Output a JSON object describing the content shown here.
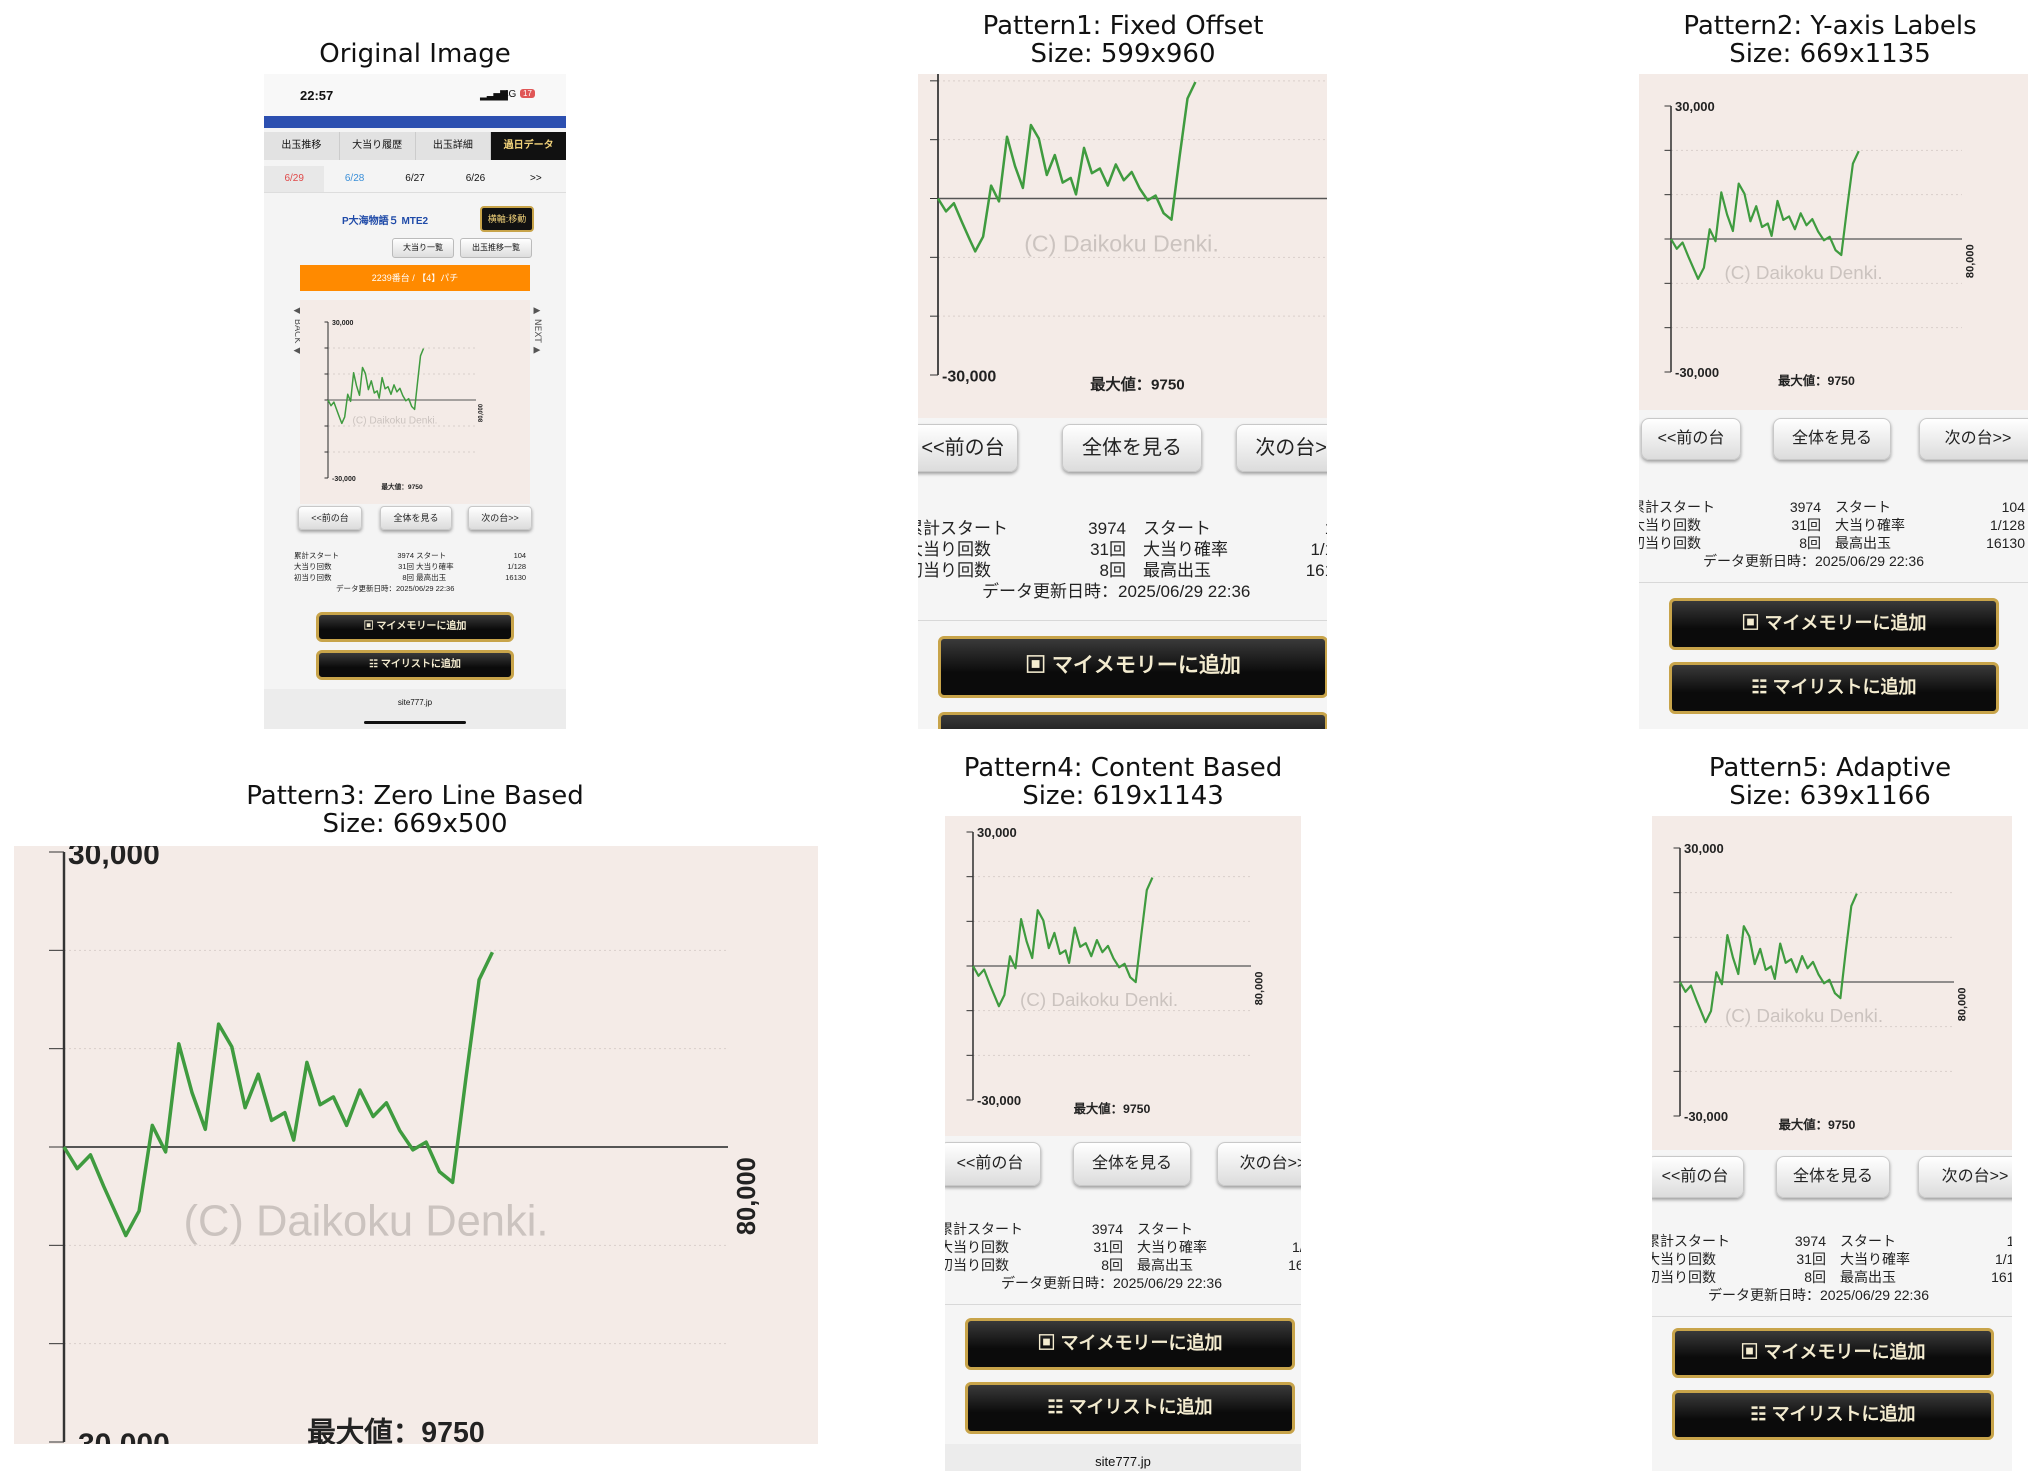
{
  "panels": {
    "original": {
      "title": "Original Image"
    },
    "p1": {
      "title": "Pattern1: Fixed Offset",
      "size": "Size: 599x960"
    },
    "p2": {
      "title": "Pattern2: Y-axis Labels",
      "size": "Size: 669x1135"
    },
    "p3": {
      "title": "Pattern3: Zero Line Based",
      "size": "Size: 669x500"
    },
    "p4": {
      "title": "Pattern4: Content Based",
      "size": "Size: 619x1143"
    },
    "p5": {
      "title": "Pattern5: Adaptive",
      "size": "Size: 639x1166"
    }
  },
  "phone": {
    "time": "22:57",
    "network": "4G",
    "battery": "17",
    "tabs": [
      "出玉推移",
      "大当り履歴",
      "出玉詳細",
      "過日データ"
    ],
    "dates": [
      "6/29",
      "6/28",
      "6/27",
      "6/26",
      ">>"
    ],
    "machine_name": "P大海物語５ MTE2",
    "move_button": "横軸:移動",
    "list_buttons": [
      "大当り一覧",
      "出玉推移一覧"
    ],
    "banner": "2239番台 / 【4】パチ",
    "back_label": "BACK",
    "next_label": "NEXT",
    "footer": "site777.jp"
  },
  "graph": {
    "y_top": "30,000",
    "y_bottom": "-30,000",
    "right_label": "80,000",
    "watermark": "(C) Daikoku Denki.",
    "max_value": "最大値：9750"
  },
  "nav_buttons": {
    "prev": "<<前の台",
    "all": "全体を見る",
    "next": "次の台>>"
  },
  "stats": {
    "total_start_label": "累計スタート",
    "total_start": "3974",
    "start_label": "スタート",
    "start": "104",
    "jackpot_label": "大当り回数",
    "jackpot": "31回",
    "prob_label": "大当り確率",
    "prob": "1/128",
    "first_label": "初当り回数",
    "first": "8回",
    "max_label": "最高出玉",
    "max": "16130",
    "updated": "データ更新日時：2025/06/29 22:36"
  },
  "actions": {
    "memory": "マイメモリーに追加",
    "list": "マイリストに追加"
  },
  "chart_data": {
    "type": "line",
    "ylim": [
      -30000,
      30000
    ],
    "x": [
      0,
      3,
      6,
      9,
      12,
      14,
      17,
      20,
      23,
      26,
      29,
      32,
      35,
      38,
      41,
      44,
      47,
      50,
      52,
      55,
      58,
      61,
      64,
      67,
      70,
      73,
      76,
      79,
      82,
      85,
      88,
      91,
      94,
      97
    ],
    "y": [
      0,
      -2200,
      -800,
      -4000,
      -7000,
      -9000,
      -6500,
      2200,
      -500,
      10500,
      5500,
      1800,
      12500,
      10200,
      4000,
      7400,
      2700,
      3500,
      700,
      8600,
      4300,
      5100,
      2200,
      5800,
      3100,
      4500,
      1700,
      -300,
      500,
      -2500,
      -3600,
      7000,
      17000,
      19800
    ],
    "color": "#3f9b3f",
    "grid": true
  }
}
